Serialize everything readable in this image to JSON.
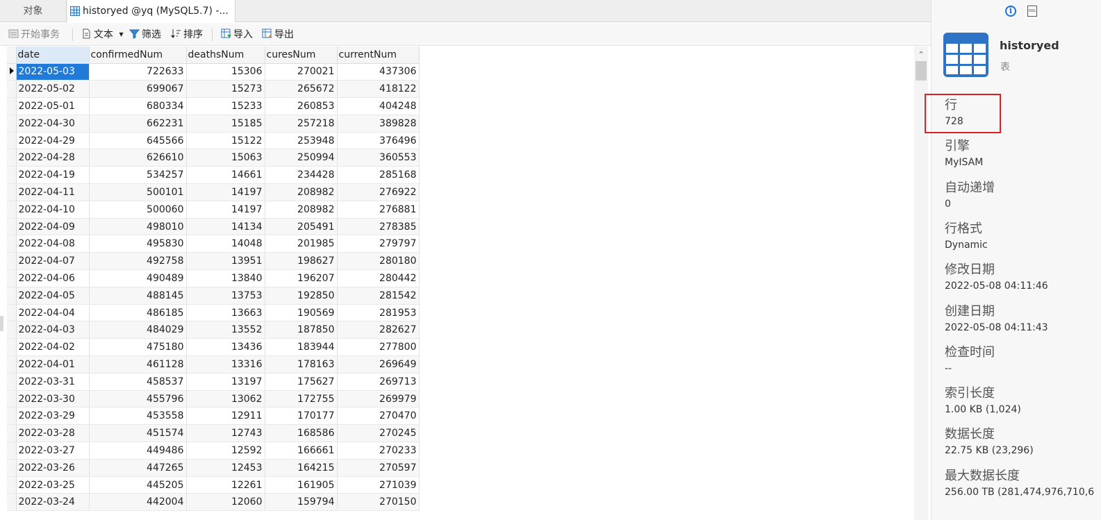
{
  "tabs": {
    "objects_label": "对象",
    "active_label": "historyed @yq (MySQL5.7) -..."
  },
  "toolbar": {
    "begin_transaction": "开始事务",
    "text": "文本",
    "filter": "筛选",
    "sort": "排序",
    "import": "导入",
    "export": "导出"
  },
  "grid": {
    "columns": [
      "date",
      "confirmedNum",
      "deathsNum",
      "curesNum",
      "currentNum"
    ],
    "rows": [
      [
        "2022-05-03",
        "722633",
        "15306",
        "270021",
        "437306"
      ],
      [
        "2022-05-02",
        "699067",
        "15273",
        "265672",
        "418122"
      ],
      [
        "2022-05-01",
        "680334",
        "15233",
        "260853",
        "404248"
      ],
      [
        "2022-04-30",
        "662231",
        "15185",
        "257218",
        "389828"
      ],
      [
        "2022-04-29",
        "645566",
        "15122",
        "253948",
        "376496"
      ],
      [
        "2022-04-28",
        "626610",
        "15063",
        "250994",
        "360553"
      ],
      [
        "2022-04-19",
        "534257",
        "14661",
        "234428",
        "285168"
      ],
      [
        "2022-04-11",
        "500101",
        "14197",
        "208982",
        "276922"
      ],
      [
        "2022-04-10",
        "500060",
        "14197",
        "208982",
        "276881"
      ],
      [
        "2022-04-09",
        "498010",
        "14134",
        "205491",
        "278385"
      ],
      [
        "2022-04-08",
        "495830",
        "14048",
        "201985",
        "279797"
      ],
      [
        "2022-04-07",
        "492758",
        "13951",
        "198627",
        "280180"
      ],
      [
        "2022-04-06",
        "490489",
        "13840",
        "196207",
        "280442"
      ],
      [
        "2022-04-05",
        "488145",
        "13753",
        "192850",
        "281542"
      ],
      [
        "2022-04-04",
        "486185",
        "13663",
        "190569",
        "281953"
      ],
      [
        "2022-04-03",
        "484029",
        "13552",
        "187850",
        "282627"
      ],
      [
        "2022-04-02",
        "475180",
        "13436",
        "183944",
        "277800"
      ],
      [
        "2022-04-01",
        "461128",
        "13316",
        "178163",
        "269649"
      ],
      [
        "2022-03-31",
        "458537",
        "13197",
        "175627",
        "269713"
      ],
      [
        "2022-03-30",
        "455796",
        "13062",
        "172755",
        "269979"
      ],
      [
        "2022-03-29",
        "453558",
        "12911",
        "170177",
        "270470"
      ],
      [
        "2022-03-28",
        "451574",
        "12743",
        "168586",
        "270245"
      ],
      [
        "2022-03-27",
        "449486",
        "12592",
        "166661",
        "270233"
      ],
      [
        "2022-03-26",
        "447265",
        "12453",
        "164215",
        "270597"
      ],
      [
        "2022-03-25",
        "445205",
        "12261",
        "161905",
        "271039"
      ],
      [
        "2022-03-24",
        "442004",
        "12060",
        "159794",
        "270150"
      ]
    ],
    "selected_row": 0
  },
  "panel": {
    "object_name": "historyed",
    "object_type": "表",
    "info_icon": "i",
    "ddl_icon": "DDL",
    "properties": [
      {
        "label": "行",
        "value": "728"
      },
      {
        "label": "引擎",
        "value": "MyISAM"
      },
      {
        "label": "自动递增",
        "value": "0"
      },
      {
        "label": "行格式",
        "value": "Dynamic"
      },
      {
        "label": "修改日期",
        "value": "2022-05-08 04:11:46"
      },
      {
        "label": "创建日期",
        "value": "2022-05-08 04:11:43"
      },
      {
        "label": "检查时间",
        "value": "--"
      },
      {
        "label": "索引长度",
        "value": "1.00 KB (1,024)"
      },
      {
        "label": "数据长度",
        "value": "22.75 KB (23,296)"
      },
      {
        "label": "最大数据长度",
        "value": "256.00 TB (281,474,976,710,6"
      }
    ]
  },
  "colors": {
    "selection": "#1f7ad8",
    "highlight": "#e02020",
    "icon_blue": "#2e73c4"
  }
}
